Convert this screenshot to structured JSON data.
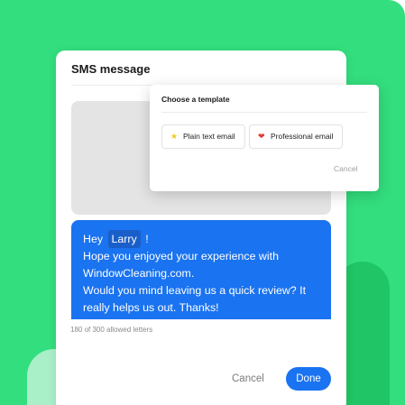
{
  "colors": {
    "background": "#33de7e",
    "primary": "#1a73f0",
    "highlight": "#1a5fc9",
    "star": "#f4c81f",
    "heart": "#e53935"
  },
  "sms_card": {
    "title": "SMS message",
    "message": {
      "greeting": "Hey",
      "name_chip": "Larry",
      "after_name": "!",
      "line_2": "Hope you enjoyed your experience with",
      "line_3": "WindowCleaning.com.",
      "line_4": "Would you mind leaving us a quick review? It",
      "line_5": "really helps us out. Thanks!"
    },
    "char_count": "180 of 300 allowed letters",
    "cancel_label": "Cancel",
    "done_label": "Done"
  },
  "template_popup": {
    "title": "Choose a template",
    "templates": [
      {
        "label": "Plain text email",
        "icon": "star-icon"
      },
      {
        "label": "Professional email",
        "icon": "heart-icon"
      }
    ],
    "cancel_label": "Cancel"
  }
}
